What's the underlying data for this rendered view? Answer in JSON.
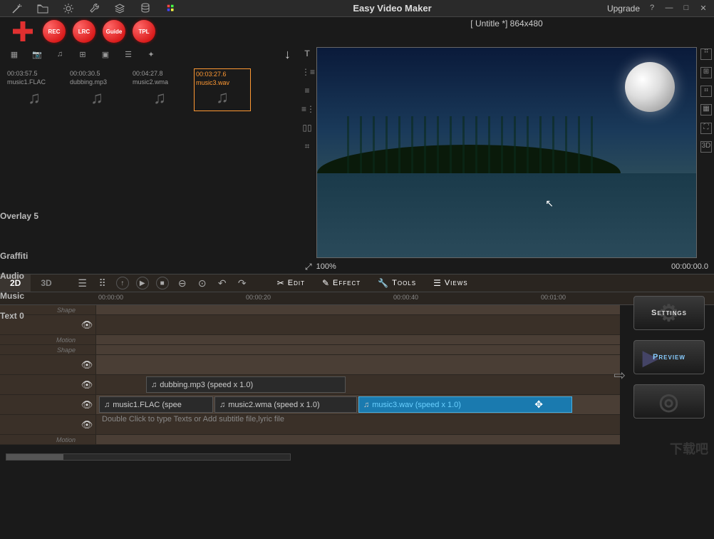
{
  "app_title": "Easy Video Maker",
  "upgrade_label": "Upgrade",
  "project_info": "[ Untitle *]  864x480",
  "round_buttons": [
    "REC",
    "LRC",
    "Guide",
    "TPL"
  ],
  "media_items": [
    {
      "time": "00:03:57.5",
      "name": "music1.FLAC",
      "selected": false
    },
    {
      "time": "00:00:30.5",
      "name": "dubbing.mp3",
      "selected": false
    },
    {
      "time": "00:04:27.8",
      "name": "music2.wma",
      "selected": false
    },
    {
      "time": "00:03:27.6",
      "name": "music3.wav",
      "selected": true
    }
  ],
  "preview": {
    "zoom": "100%",
    "timecode": "00:00:00.0"
  },
  "mode_tabs": {
    "d2": "2D",
    "d3": "3D"
  },
  "menus": {
    "edit": "Edit",
    "effect": "Effect",
    "tools": "Tools",
    "views": "Views"
  },
  "ruler": [
    "00:00:00",
    "00:00:20",
    "00:00:40",
    "00:01:00"
  ],
  "tracks": {
    "shape_sub": "Shape",
    "overlay5": "Overlay 5",
    "motion_sub": "Motion",
    "shape_sub2": "Shape",
    "graffiti": "Graffiti",
    "audio": "Audio",
    "music": "Music",
    "text0": "Text 0",
    "motion_sub2": "Motion"
  },
  "clips": {
    "audio": "dubbing.mp3  (speed x 1.0)",
    "music1": "music1.FLAC  (spee",
    "music2": "music2.wma  (speed x 1.0)",
    "music3": "music3.wav  (speed x 1.0)"
  },
  "text_placeholder": "Double Click to type Texts or Add subtitle file,lyric file",
  "buttons": {
    "settings": "Settings",
    "preview": "Preview"
  }
}
